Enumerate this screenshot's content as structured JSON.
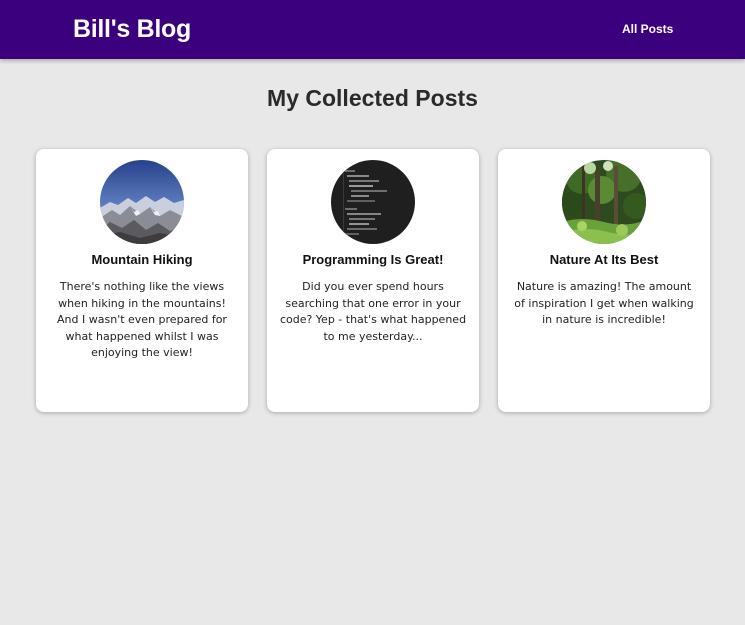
{
  "header": {
    "brand": "Bill's Blog",
    "nav_link": "All Posts",
    "background_color": "#3a007e"
  },
  "main": {
    "title": "My Collected Posts"
  },
  "posts": [
    {
      "image": "mountain-photo",
      "title": "Mountain Hiking",
      "excerpt": "There's nothing like the views when hiking in the mountains! And I wasn't even prepared for what happened whilst I was enjoying the view!"
    },
    {
      "image": "code-screenshot",
      "title": "Programming Is Great!",
      "excerpt": "Did you ever spend hours searching that one error in your code? Yep - that's what happened to me yesterday..."
    },
    {
      "image": "forest-photo",
      "title": "Nature At Its Best",
      "excerpt": "Nature is amazing! The amount of inspiration I get when walking in nature is incredible!"
    }
  ]
}
